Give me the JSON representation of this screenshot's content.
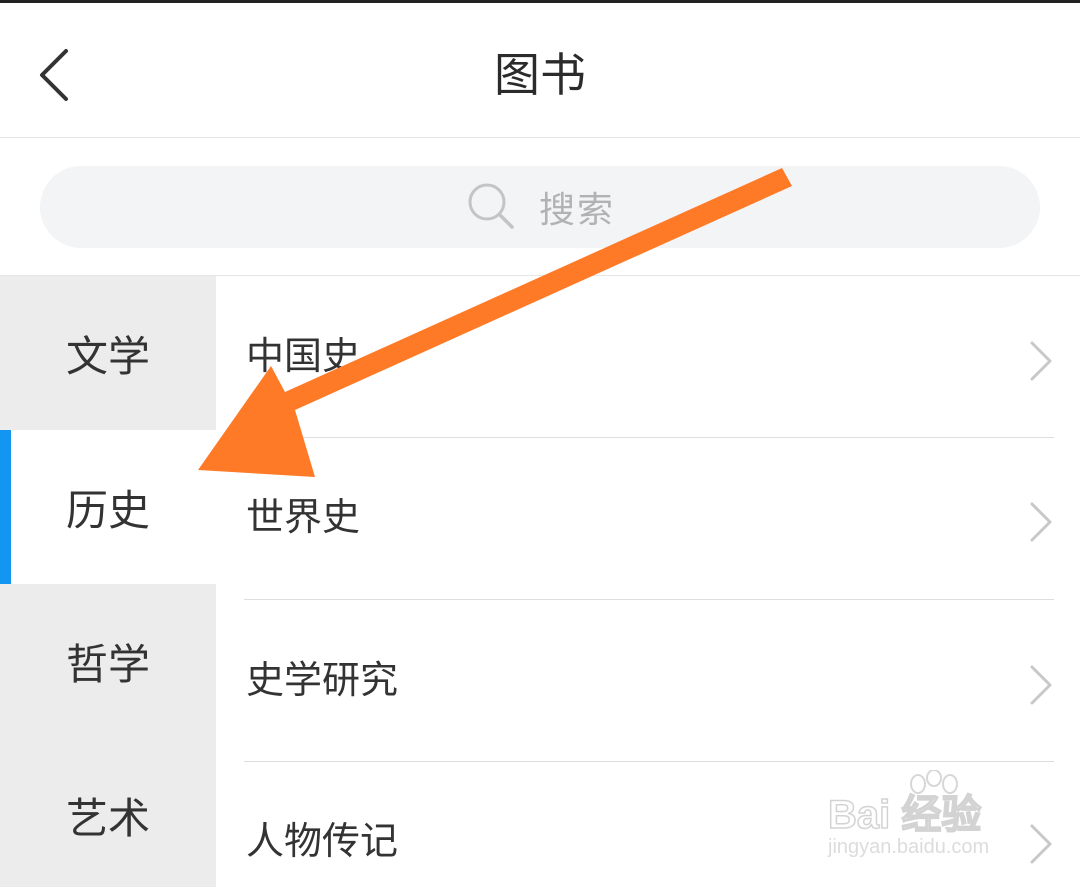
{
  "header": {
    "title": "图书"
  },
  "search": {
    "placeholder": "搜索"
  },
  "sidebar": {
    "items": [
      {
        "label": "文学",
        "active": false
      },
      {
        "label": "历史",
        "active": true
      },
      {
        "label": "哲学",
        "active": false
      },
      {
        "label": "艺术",
        "active": false
      }
    ]
  },
  "subcategories": [
    {
      "label": "中国史"
    },
    {
      "label": "世界史"
    },
    {
      "label": "史学研究"
    },
    {
      "label": "人物传记"
    }
  ],
  "watermark": {
    "brand": "Bai 经验",
    "url": "jingyan.baidu.com"
  },
  "colors": {
    "accent": "#1296f2",
    "annotation_arrow": "#ff7a27",
    "sidebar_bg": "#ececec",
    "search_bg": "#f3f4f6"
  }
}
